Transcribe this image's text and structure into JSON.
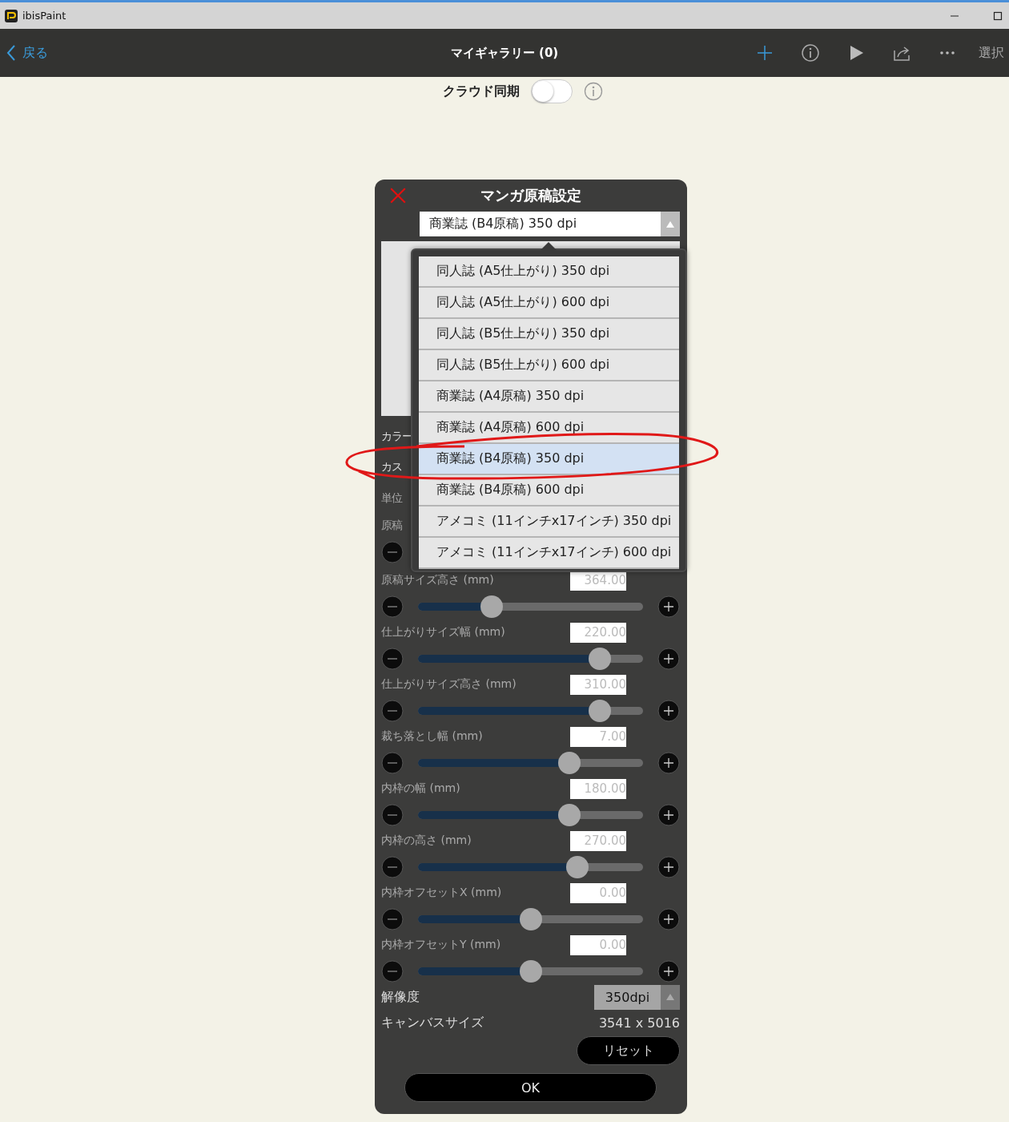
{
  "window": {
    "title": "ibisPaint"
  },
  "nav": {
    "back": "戻る",
    "title": "マイギャラリー (0)",
    "select": "選択"
  },
  "cloud_sync": {
    "label": "クラウド同期",
    "on": false
  },
  "dialog": {
    "title": "マンガ原稿設定",
    "preset": "商業誌 (B4原稿) 350 dpi",
    "covered_labels": [
      "カラー",
      "カス",
      "単位"
    ],
    "sliders": [
      {
        "label": "原稿"
      },
      {
        "label": "原稿サイズ高さ (mm)",
        "value": "364.00",
        "level": 0.31
      },
      {
        "label": "仕上がりサイズ幅 (mm)",
        "value": "220.00",
        "level": 0.84
      },
      {
        "label": "仕上がりサイズ高さ (mm)",
        "value": "310.00",
        "level": 0.84
      },
      {
        "label": "裁ち落とし幅 (mm)",
        "value": "7.00",
        "level": 0.69
      },
      {
        "label": "内枠の幅 (mm)",
        "value": "180.00",
        "level": 0.69
      },
      {
        "label": "内枠の高さ (mm)",
        "value": "270.00",
        "level": 0.73
      },
      {
        "label": "内枠オフセットX (mm)",
        "value": "0.00",
        "level": 0.5
      },
      {
        "label": "内枠オフセットY (mm)",
        "value": "0.00",
        "level": 0.5
      }
    ],
    "resolution": {
      "label": "解像度",
      "value": "350dpi"
    },
    "canvas_size": {
      "label": "キャンバスサイズ",
      "value": "3541 x 5016"
    },
    "reset": "リセット",
    "ok": "OK"
  },
  "preset_menu": [
    {
      "label": "同人誌 (A5仕上がり) 350 dpi",
      "selected": false
    },
    {
      "label": "同人誌 (A5仕上がり) 600 dpi",
      "selected": false
    },
    {
      "label": "同人誌 (B5仕上がり) 350 dpi",
      "selected": false
    },
    {
      "label": "同人誌 (B5仕上がり) 600 dpi",
      "selected": false
    },
    {
      "label": "商業誌 (A4原稿) 350 dpi",
      "selected": false
    },
    {
      "label": "商業誌 (A4原稿) 600 dpi",
      "selected": false
    },
    {
      "label": "商業誌 (B4原稿) 350 dpi",
      "selected": true
    },
    {
      "label": "商業誌 (B4原稿) 600 dpi",
      "selected": false
    },
    {
      "label": "アメコミ (11インチx17インチ) 350 dpi",
      "selected": false
    },
    {
      "label": "アメコミ (11インチx17インチ) 600 dpi",
      "selected": false
    }
  ]
}
